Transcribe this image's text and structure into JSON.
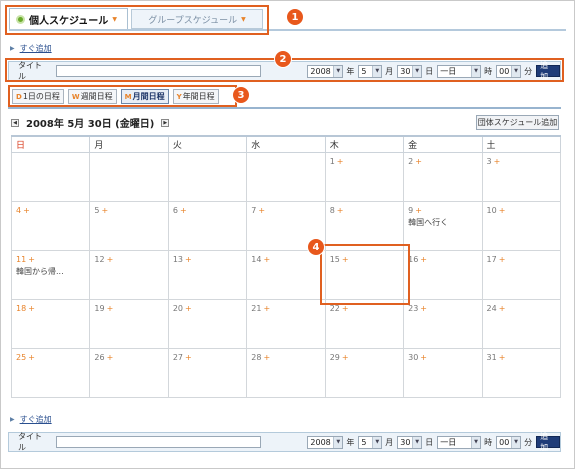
{
  "tabs": {
    "personal": "個人スケジュール",
    "group": "グループスケジュール"
  },
  "badges": [
    "1",
    "2",
    "3",
    "4"
  ],
  "quick_add_label": "すぐ追加",
  "quick_form": {
    "title_label": "タイトル",
    "year": "2008",
    "year_unit": "年",
    "month": "5",
    "month_unit": "月",
    "day": "30",
    "day_unit": "日",
    "period": "一日",
    "hour_unit": "時",
    "minute": "00",
    "minute_unit": "分",
    "add_button": "追加"
  },
  "view_buttons": [
    {
      "icon": "D",
      "label": "1日の日程"
    },
    {
      "icon": "W",
      "label": "週間日程"
    },
    {
      "icon": "M",
      "label": "月間日程"
    },
    {
      "icon": "Y",
      "label": "年間日程"
    }
  ],
  "current_date": "2008年 5月 30日 (金曜日)",
  "group_schedule_button": "団体スケジュール追加",
  "weekdays": [
    "日",
    "月",
    "火",
    "水",
    "木",
    "金",
    "土"
  ],
  "weeks": [
    [
      {
        "d": ""
      },
      {
        "d": ""
      },
      {
        "d": ""
      },
      {
        "d": ""
      },
      {
        "d": "1"
      },
      {
        "d": "2"
      },
      {
        "d": "3"
      }
    ],
    [
      {
        "d": "4"
      },
      {
        "d": "5"
      },
      {
        "d": "6"
      },
      {
        "d": "7"
      },
      {
        "d": "8"
      },
      {
        "d": "9",
        "ev": "韓国へ行く"
      },
      {
        "d": "10"
      }
    ],
    [
      {
        "d": "11",
        "ev": "韓国から帰..."
      },
      {
        "d": "12"
      },
      {
        "d": "13"
      },
      {
        "d": "14"
      },
      {
        "d": "15"
      },
      {
        "d": "16"
      },
      {
        "d": "17"
      }
    ],
    [
      {
        "d": "18"
      },
      {
        "d": "19"
      },
      {
        "d": "20"
      },
      {
        "d": "21"
      },
      {
        "d": "22"
      },
      {
        "d": "23"
      },
      {
        "d": "24"
      }
    ],
    [
      {
        "d": "25"
      },
      {
        "d": "26"
      },
      {
        "d": "27"
      },
      {
        "d": "28"
      },
      {
        "d": "29"
      },
      {
        "d": "30"
      },
      {
        "d": "31"
      }
    ]
  ],
  "plus_glyph": "+",
  "colors": {
    "highlight": "#e06020",
    "accent": "#e8832a",
    "sunday": "#d93a1b"
  }
}
